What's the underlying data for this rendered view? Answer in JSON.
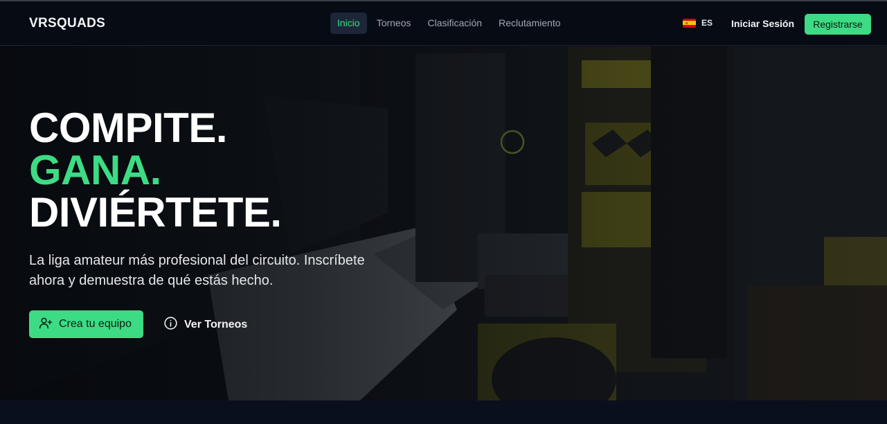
{
  "brand": {
    "logo_text": "VRSQUADS"
  },
  "nav": {
    "links": [
      {
        "label": "Inicio",
        "active": true
      },
      {
        "label": "Torneos",
        "active": false
      },
      {
        "label": "Clasificación",
        "active": false
      },
      {
        "label": "Reclutamiento",
        "active": false
      }
    ]
  },
  "header": {
    "language": {
      "flag_icon": "spain-flag-icon",
      "code": "ES"
    },
    "login_label": "Iniciar Sesión",
    "register_label": "Registrarse"
  },
  "hero": {
    "headline_line1": "COMPITE.",
    "headline_line2": "GANA.",
    "headline_line3": "DIVIÉRTETE.",
    "subtitle": "La liga amateur más profesional del circuito. Inscríbete ahora y demuestra de qué estás hecho.",
    "primary_button": {
      "label": "Crea tu equipo",
      "icon": "user-plus-icon"
    },
    "secondary_button": {
      "label": "Ver Torneos",
      "icon": "info-circle-icon"
    }
  },
  "colors": {
    "accent": "#3ddc84",
    "nav_background": "#060b14",
    "page_background": "#0a0e17"
  }
}
